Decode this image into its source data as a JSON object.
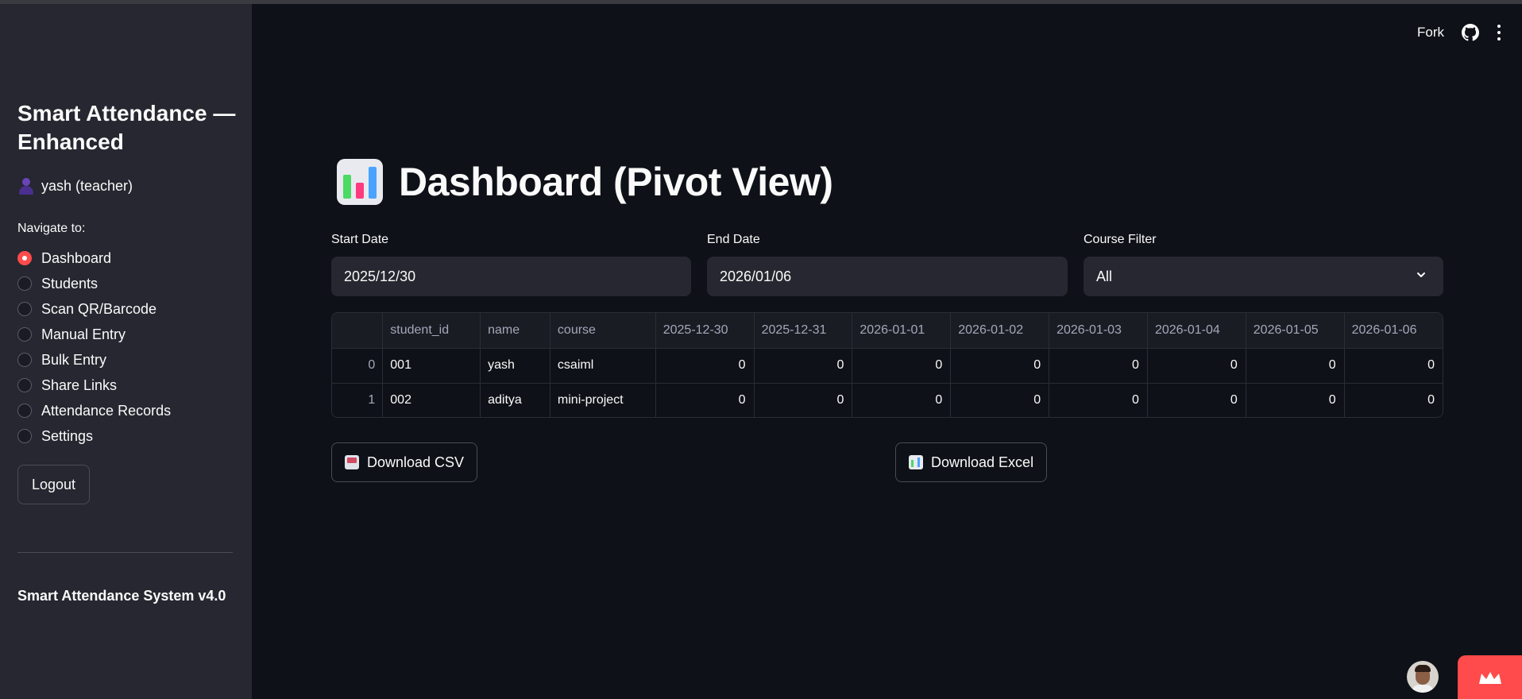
{
  "sidebar": {
    "title": "Smart Attendance — Enhanced",
    "user": "yash (teacher)",
    "nav_label": "Navigate to:",
    "nav_items": [
      {
        "label": "Dashboard",
        "selected": true
      },
      {
        "label": "Students",
        "selected": false
      },
      {
        "label": "Scan QR/Barcode",
        "selected": false
      },
      {
        "label": "Manual Entry",
        "selected": false
      },
      {
        "label": "Bulk Entry",
        "selected": false
      },
      {
        "label": "Share Links",
        "selected": false
      },
      {
        "label": "Attendance Records",
        "selected": false
      },
      {
        "label": "Settings",
        "selected": false
      }
    ],
    "logout_label": "Logout",
    "version": "Smart Attendance System v4.0"
  },
  "header": {
    "fork_label": "Fork",
    "icons": [
      "github-icon",
      "kebab-menu-icon"
    ]
  },
  "main": {
    "title": "Dashboard (Pivot View)",
    "title_icon": "bar-chart-icon",
    "filters": {
      "start_date": {
        "label": "Start Date",
        "value": "2025/12/30"
      },
      "end_date": {
        "label": "End Date",
        "value": "2026/01/06"
      },
      "course": {
        "label": "Course Filter",
        "value": "All"
      }
    },
    "table": {
      "columns": [
        "",
        "student_id",
        "name",
        "course",
        "2025-12-30",
        "2025-12-31",
        "2026-01-01",
        "2026-01-02",
        "2026-01-03",
        "2026-01-04",
        "2026-01-05",
        "2026-01-06"
      ],
      "rows": [
        [
          "0",
          "001",
          "yash",
          "csaiml",
          "0",
          "0",
          "0",
          "0",
          "0",
          "0",
          "0",
          "0"
        ],
        [
          "1",
          "002",
          "aditya",
          "mini-project",
          "0",
          "0",
          "0",
          "0",
          "0",
          "0",
          "0",
          "0"
        ]
      ]
    },
    "download_csv_label": "Download CSV",
    "download_excel_label": "Download Excel"
  },
  "colors": {
    "background": "#0e1117",
    "sidebar": "#262730",
    "accent": "#ff4b4b",
    "text": "#fafafa"
  }
}
